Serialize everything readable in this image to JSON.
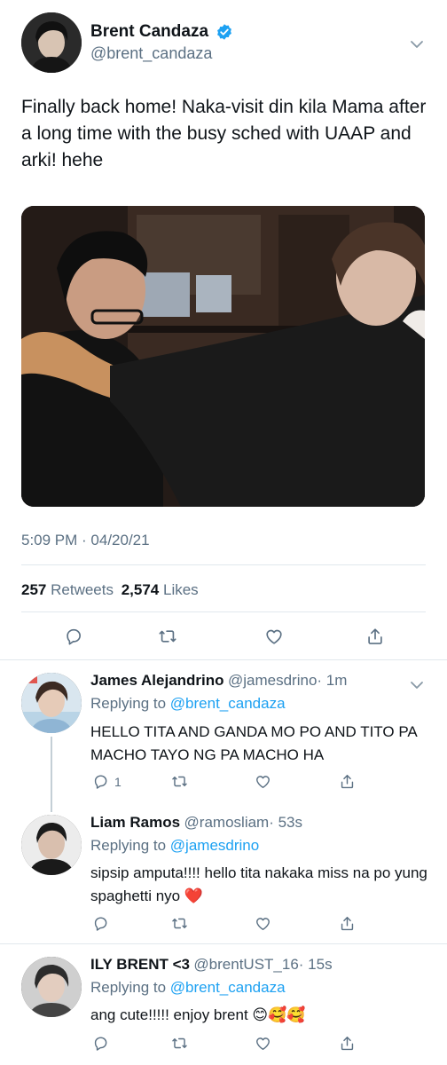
{
  "main": {
    "author_name": "Brent Candaza",
    "author_handle": "@brent_candaza",
    "text": "Finally back home! Naka-visit din kila Mama after a long time with the busy sched with UAAP and arki! hehe",
    "time": "5:09 PM · 04/20/21",
    "retweets_count": "257",
    "retweets_label": "Retweets",
    "likes_count": "2,574",
    "likes_label": "Likes"
  },
  "replies": [
    {
      "name": "James Alejandrino",
      "handle": "@jamesdrino",
      "time": "· 1m",
      "replying_prefix": "Replying to",
      "replying_to": "@brent_candaza",
      "text": "HELLO TITA AND GANDA MO PO AND TITO PA MACHO TAYO NG PA MACHO HA",
      "reply_count": "1"
    },
    {
      "name": "Liam Ramos",
      "handle": "@ramosliam",
      "time": "· 53s",
      "replying_prefix": "Replying to",
      "replying_to": "@jamesdrino",
      "text": "sipsip amputa!!!! hello tita nakaka miss na po yung spaghetti nyo ❤️"
    },
    {
      "name": "ILY BRENT <3",
      "handle": "@brentUST_16",
      "time": "· 15s",
      "replying_prefix": "Replying to",
      "replying_to": "@brent_candaza",
      "text": "ang cute!!!!! enjoy brent 😊🥰🥰"
    }
  ],
  "icons": {
    "reply": "reply-icon",
    "retweet": "retweet-icon",
    "like": "heart-icon",
    "share": "share-icon",
    "verified": "verified-badge-icon",
    "more": "chevron-down-icon"
  },
  "colors": {
    "accent": "#1da1f2",
    "secondary_text": "#5b7083",
    "divider": "#e1e8ed"
  }
}
